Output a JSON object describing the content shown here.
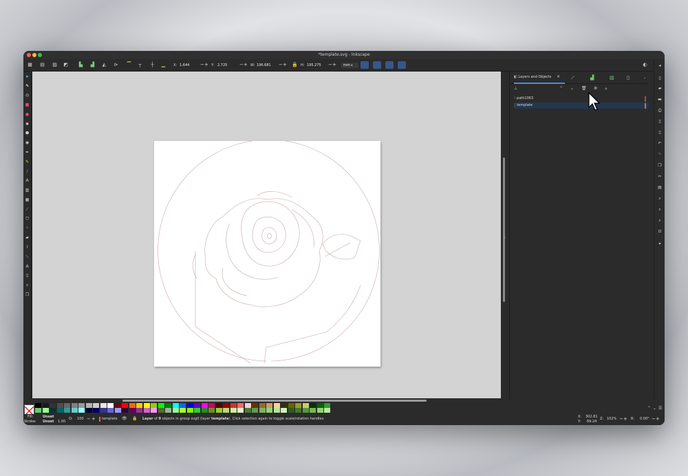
{
  "window": {
    "title": "*template.svg - Inkscape",
    "traffic_colors": [
      "#ff5f57",
      "#febc2e",
      "#28c840"
    ]
  },
  "toolbar": {
    "x_label": "X:",
    "x_value": "1.644",
    "y_label": "Y:",
    "y_value": "2.725",
    "w_label": "W:",
    "w_value": "196.681",
    "h_label": "H:",
    "h_value": "195.275",
    "unit": "mm",
    "minus": "−",
    "plus": "+"
  },
  "panel": {
    "tab_label": "Layers and Objects",
    "tab_close": "×",
    "layers": [
      {
        "name": "path1063",
        "color": "#a05050"
      },
      {
        "name": "template",
        "color": "#e06a3a"
      }
    ]
  },
  "palette": {
    "colors": [
      "#000000",
      "#1a1a1a",
      "#333333",
      "#4d4d4d",
      "#666666",
      "#808080",
      "#999999",
      "#b3b3b3",
      "#cccccc",
      "#e6e6e6",
      "#ffffff",
      "#800000",
      "#ff0000",
      "#ff6600",
      "#ffcc00",
      "#ffff00",
      "#99cc00",
      "#00ff00",
      "#008000",
      "#00ffff",
      "#0066ff",
      "#0000ff",
      "#6600cc",
      "#ff00ff",
      "#cc0066",
      "#4d0000",
      "#990000",
      "#cc3333",
      "#ff6666",
      "#ffcccc",
      "#663300",
      "#996633",
      "#cc9966",
      "#ffcc99",
      "#333300",
      "#666600",
      "#999933",
      "#cccc66",
      "#003300",
      "#006600",
      "#339933",
      "#66cc66",
      "#99ff99",
      "#003333",
      "#006666",
      "#339999",
      "#66cccc",
      "#99ffff",
      "#000033",
      "#000066",
      "#333399",
      "#6666cc",
      "#9999ff",
      "#330033",
      "#660066",
      "#993399",
      "#cc66cc",
      "#ff99ff",
      "#556b2f",
      "#8fbc8f",
      "#98fb98",
      "#adff2f",
      "#7fff00",
      "#32cd32",
      "#228b22",
      "#6b8e23",
      "#9acd32",
      "#b8d87a",
      "#d4e8a0",
      "#e6f0c8",
      "#4a7a3a",
      "#5d9c4a",
      "#79b85c",
      "#94d176",
      "#b2e69a",
      "#cdf2bd",
      "#2e5d20",
      "#3f7a2c",
      "#56993d",
      "#72b852",
      "#93d470",
      "#bbe89c"
    ]
  },
  "status": {
    "fill_label": "Fill:",
    "fill_value": "Unset",
    "stroke_label": "Stroke:",
    "stroke_value": "Unset",
    "stroke_width": "1.00",
    "opacity_label": "O:",
    "opacity_value": "100",
    "layer_name": "template",
    "message_pre": "Layer",
    "message_of": " of ",
    "message_count": "0",
    "message_mid": " objects in group svg0 (layer ",
    "message_layer": "template",
    "message_post": "). Click selection again to toggle scale/rotation handles.",
    "x_label": "X:",
    "x_value": "302.81",
    "y_label": "Y:",
    "y_value": "69.24",
    "zoom_label": "Z:",
    "zoom_value": "102%",
    "rotation_label": "R:",
    "rotation_value": "0.00°"
  }
}
